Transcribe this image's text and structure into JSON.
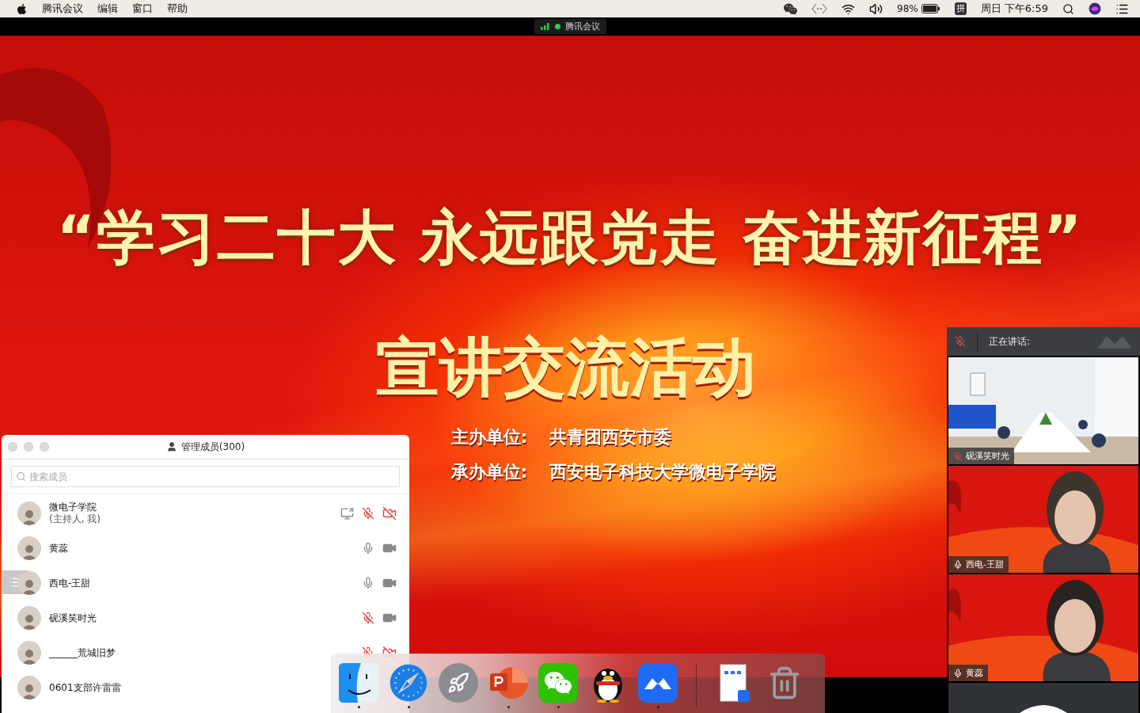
{
  "menu_bar": {
    "menus": [
      "腾讯会议",
      "编辑",
      "窗口",
      "帮助"
    ],
    "battery": "98%",
    "input_method": "拼",
    "clock": "周日 下午6:59"
  },
  "meeting_tag": {
    "title": "腾讯会议"
  },
  "slide": {
    "title": "“学习二十大 永远跟党走 奋进新征程”",
    "subtitle": "宣讲交流活动",
    "organizers": [
      {
        "label": "主办单位:",
        "value": "共青团西安市委"
      },
      {
        "label": "承办单位:",
        "value": "西安电子科技大学微电子学院"
      }
    ]
  },
  "members_panel": {
    "title": "管理成员(300)",
    "search": {
      "placeholder": "搜索成员"
    },
    "members": [
      {
        "name": "微电子学院",
        "role": "(主持人, 我)",
        "sharing": true,
        "mic_muted": true,
        "camera_off": true,
        "hovered": false
      },
      {
        "name": "黄蕊",
        "sharing": false,
        "mic_muted": false,
        "camera_off": false,
        "hovered": false
      },
      {
        "name": "西电-王甜",
        "sharing": false,
        "mic_muted": false,
        "camera_off": false,
        "hovered": true
      },
      {
        "name": "砚溪笑时光",
        "sharing": false,
        "mic_muted": true,
        "camera_off": false,
        "hovered": false
      },
      {
        "name": "______荒城旧梦",
        "sharing": false,
        "mic_muted": true,
        "camera_off": true,
        "hovered": false
      },
      {
        "name": "0601支部许雷雷",
        "hovered": false
      }
    ]
  },
  "speaker_panel": {
    "label": "正在讲话:",
    "mic_muted": true,
    "tiles": [
      {
        "kind": "room",
        "name": "砚溪笑时光",
        "mic_muted": true
      },
      {
        "kind": "person",
        "name": "西电-王甜",
        "mic_muted": false
      },
      {
        "kind": "person",
        "name": "黄蕊",
        "mic_muted": false
      },
      {
        "kind": "avatar"
      }
    ]
  },
  "dock": {
    "apps": [
      {
        "kind": "finder",
        "running": true
      },
      {
        "kind": "safari",
        "running": true
      },
      {
        "kind": "launchpad",
        "running": false
      },
      {
        "kind": "slides",
        "running": true
      },
      {
        "kind": "chat",
        "running": true
      },
      {
        "kind": "penguin",
        "running": false
      },
      {
        "kind": "meeting",
        "running": true
      },
      {
        "kind": "divider"
      },
      {
        "kind": "document",
        "running": false
      },
      {
        "kind": "trash",
        "running": false
      }
    ]
  }
}
